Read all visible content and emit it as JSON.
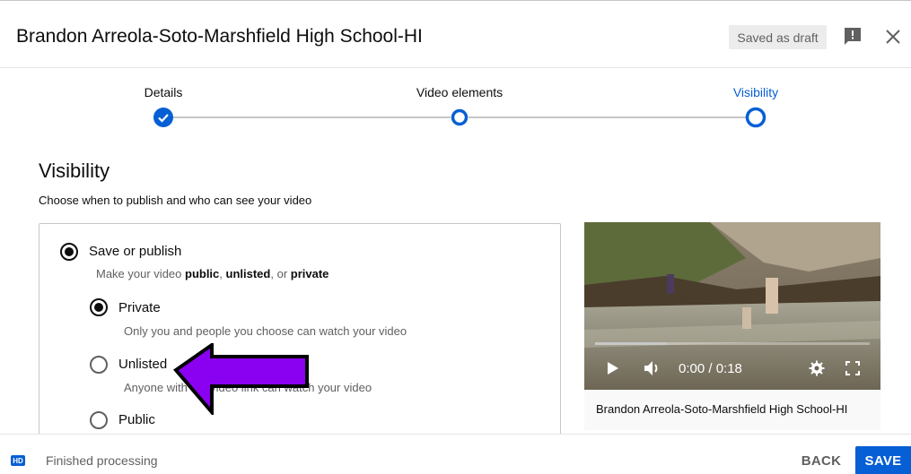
{
  "header": {
    "title": "Brandon Arreola-Soto-Marshfield High School-HI",
    "draft_status": "Saved as draft",
    "icons": [
      "feedback-icon",
      "close-icon"
    ]
  },
  "stepper": {
    "steps": [
      {
        "label": "Details",
        "state": "completed"
      },
      {
        "label": "Video elements",
        "state": "visited"
      },
      {
        "label": "Visibility",
        "state": "current"
      }
    ],
    "accent_color": "#065fd4"
  },
  "visibility": {
    "heading": "Visibility",
    "subheading": "Choose when to publish and who can see your video",
    "save_or_publish": {
      "label": "Save or publish",
      "desc_prefix": "Make your video ",
      "desc_public": "public",
      "desc_sep1": ", ",
      "desc_unlisted": "unlisted",
      "desc_sep2": ", or ",
      "desc_private": "private",
      "selected": true
    },
    "options": [
      {
        "label": "Private",
        "desc": "Only you and people you choose can watch your video",
        "selected": true
      },
      {
        "label": "Unlisted",
        "desc": "Anyone with the video link can watch your video",
        "selected": false
      },
      {
        "label": "Public",
        "desc": "",
        "selected": false
      }
    ],
    "overlay_arrow_color": "#8a00f0"
  },
  "video_preview": {
    "time": "0:00 / 0:18",
    "progress_fraction": 0.26,
    "caption": "Brandon Arreola-Soto-Marshfield High School-HI",
    "icons": [
      "play-icon",
      "volume-icon",
      "gear-icon",
      "fullscreen-icon"
    ]
  },
  "footer": {
    "badge": "HD",
    "status": "Finished processing",
    "back_label": "BACK",
    "save_label": "SAVE"
  }
}
